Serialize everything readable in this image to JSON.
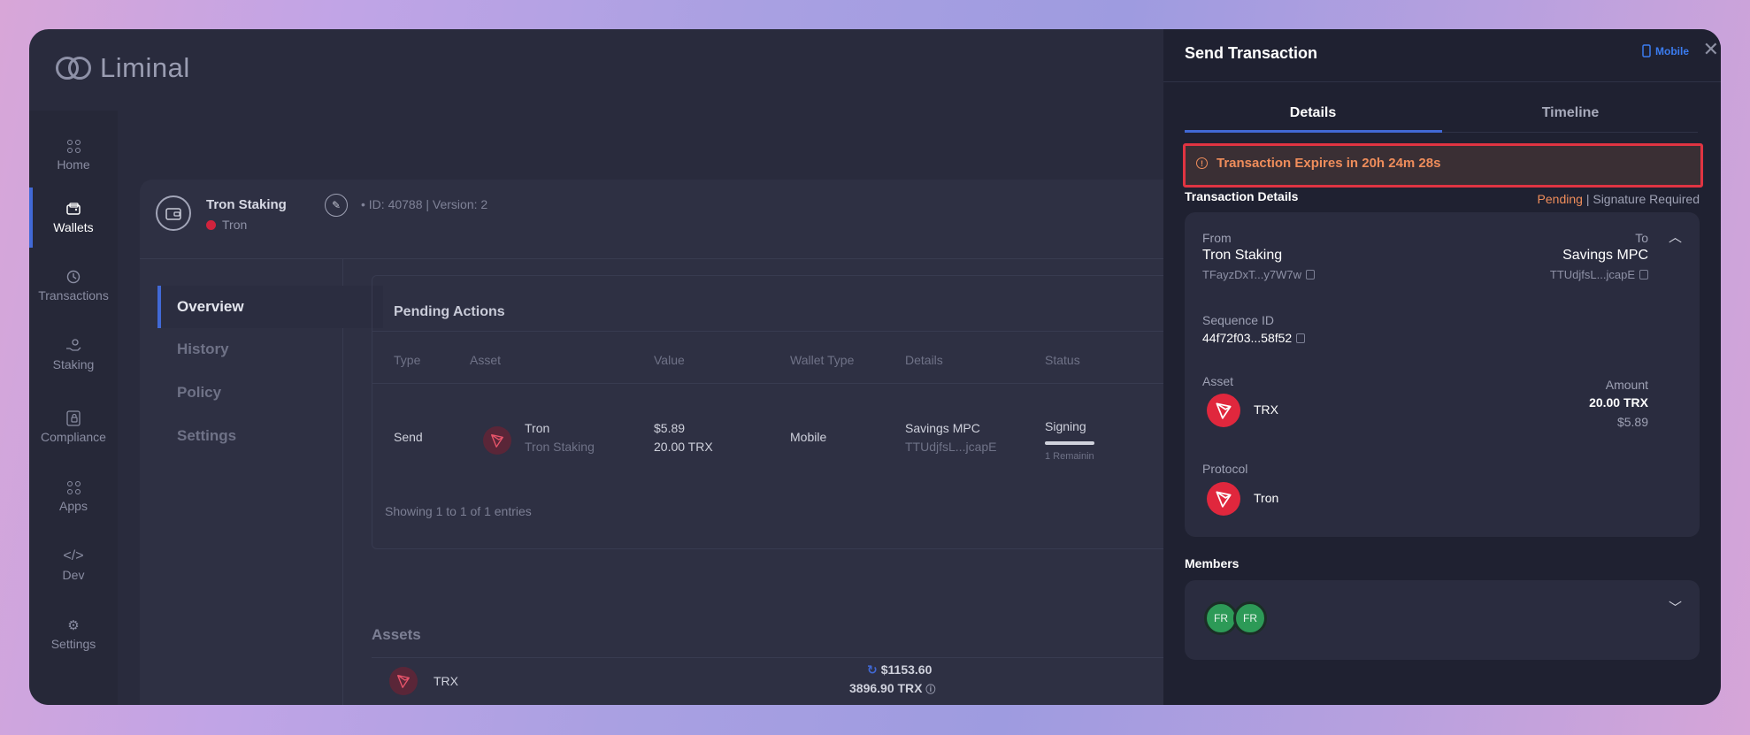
{
  "app": {
    "name": "Liminal"
  },
  "nav": {
    "items": [
      {
        "label": "Home",
        "icon": "home-grid-icon"
      },
      {
        "label": "Wallets",
        "icon": "wallet-icon",
        "active": true
      },
      {
        "label": "Transactions",
        "icon": "clock-icon"
      },
      {
        "label": "Staking",
        "icon": "staking-hand-icon"
      },
      {
        "label": "Compliance",
        "icon": "compliance-lock-icon"
      },
      {
        "label": "Apps",
        "icon": "apps-grid-icon"
      },
      {
        "label": "Dev",
        "icon": "code-icon"
      },
      {
        "label": "Settings",
        "icon": "gear-icon"
      }
    ]
  },
  "wallet": {
    "name": "Tron Staking",
    "meta": "ID: 40788 | Version: 2",
    "chain": "Tron",
    "chain_color": "#d0233d"
  },
  "subnav": {
    "items": [
      "Overview",
      "History",
      "Policy",
      "Settings"
    ],
    "active": "Overview"
  },
  "pending": {
    "title": "Pending Actions",
    "columns": [
      "Type",
      "Asset",
      "Value",
      "Wallet Type",
      "Details",
      "Status"
    ],
    "row": {
      "type": "Send",
      "asset_name": "Tron",
      "asset_sub": "Tron Staking",
      "value_usd": "$5.89",
      "value_amount": "20.00 TRX",
      "wallet_type": "Mobile",
      "details_name": "Savings MPC",
      "details_addr": "TTUdjfsL...jcapE",
      "status": "Signing",
      "status_sub": "1 Remainin"
    },
    "showing": "Showing 1 to 1 of 1 entries"
  },
  "assets": {
    "title": "Assets",
    "rows": [
      {
        "symbol": "TRX",
        "usd": "$1153.60",
        "amount": "3896.90 TRX"
      }
    ]
  },
  "panel": {
    "title": "Send Transaction",
    "mobile_label": "Mobile",
    "tabs": [
      "Details",
      "Timeline"
    ],
    "active_tab": "Details",
    "expire_text": "Transaction Expires in 20h 24m 28s",
    "details_title": "Transaction Details",
    "status_pending": "Pending",
    "status_sep": " | ",
    "status_rest": "Signature Required",
    "from_label": "From",
    "from_name": "Tron Staking",
    "from_addr": "TFayzDxT...y7W7w",
    "to_label": "To",
    "to_name": "Savings MPC",
    "to_addr": "TTUdjfsL...jcapE",
    "seq_label": "Sequence ID",
    "seq_value": "44f72f03...58f52",
    "asset_label": "Asset",
    "asset_symbol": "TRX",
    "amount_label": "Amount",
    "amount_value": "20.00 TRX",
    "amount_usd": "$5.89",
    "protocol_label": "Protocol",
    "protocol_value": "Tron",
    "members_title": "Members",
    "members": [
      "FR",
      "FR"
    ]
  },
  "colors": {
    "accent": "#4169d6",
    "warning": "#ef8d5b",
    "highlight_border": "#e03442",
    "tron_red": "#e0273d",
    "member_green": "#2d9a57"
  }
}
